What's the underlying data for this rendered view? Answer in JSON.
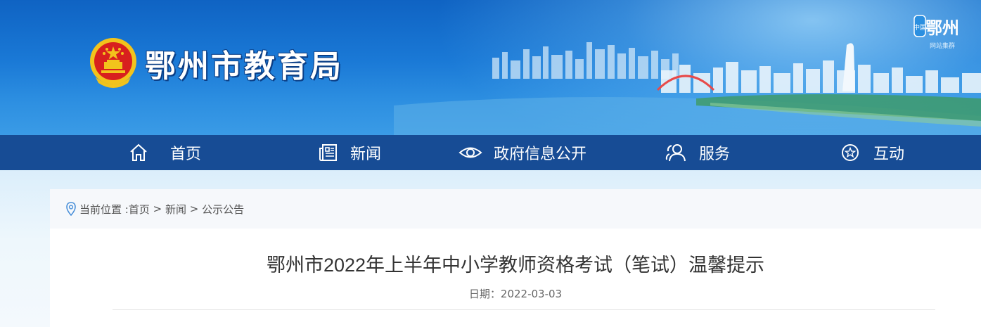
{
  "header": {
    "site_title": "鄂州市教育局",
    "seal_text_main": "鄂州",
    "seal_text_small": "中国",
    "seal_text_sub": "网站集群"
  },
  "nav": {
    "items": [
      {
        "label": "首页",
        "icon": "home-icon"
      },
      {
        "label": "新闻",
        "icon": "newspaper-icon"
      },
      {
        "label": "政府信息公开",
        "icon": "eye-icon"
      },
      {
        "label": "服务",
        "icon": "users-icon"
      },
      {
        "label": "互动",
        "icon": "star-icon"
      }
    ]
  },
  "breadcrumb": {
    "prefix": "当前位置 :",
    "items": [
      "首页",
      "新闻",
      "公示公告"
    ],
    "separator": " > "
  },
  "article": {
    "title": "鄂州市2022年上半年中小学教师资格考试（笔试）温馨提示",
    "date_label": "日期：",
    "date": "2022-03-03"
  },
  "colors": {
    "nav_bg": "#174c95",
    "banner_blue": "#1a79d6",
    "emblem_red": "#d8201e",
    "emblem_gold": "#f2c31c"
  }
}
